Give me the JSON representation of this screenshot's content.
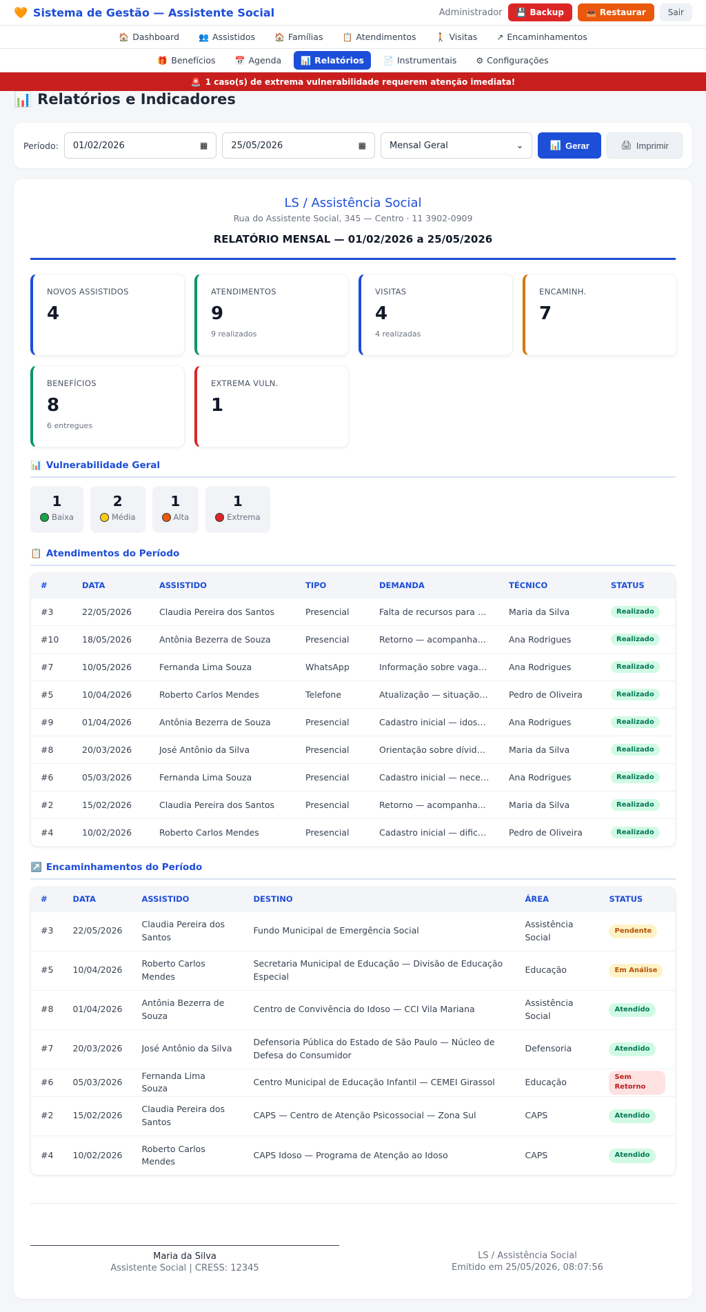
{
  "app": {
    "title": "Sistema de Gestão — Assistente Social",
    "user": "Administrador",
    "backup": "Backup",
    "restore": "Restaurar",
    "logout": "Sair"
  },
  "nav1": [
    {
      "label": "Dashboard",
      "icon": "🏠"
    },
    {
      "label": "Assistidos",
      "icon": "👥"
    },
    {
      "label": "Famílias",
      "icon": "🏠"
    },
    {
      "label": "Atendimentos",
      "icon": "📋"
    },
    {
      "label": "Visitas",
      "icon": "🚶"
    },
    {
      "label": "Encaminhamentos",
      "icon": "↗"
    }
  ],
  "nav2": [
    {
      "label": "Benefícios",
      "icon": "🎁"
    },
    {
      "label": "Agenda",
      "icon": "📅"
    },
    {
      "label": "Relatórios",
      "icon": "📊"
    },
    {
      "label": "Instrumentais",
      "icon": "📄"
    },
    {
      "label": "Configurações",
      "icon": "⚙"
    }
  ],
  "alert": "1 caso(s) de extrema vulnerabilidade requerem atenção imediata!",
  "page_title": "Relatórios e Indicadores",
  "filters": {
    "period_label": "Período:",
    "date_from": "01/02/2026",
    "date_to": "25/05/2026",
    "report_type": "Mensal Geral",
    "generate": "Gerar",
    "print": "Imprimir"
  },
  "report": {
    "org_name": "LS / Assistência Social",
    "org_address": "Rua do Assistente Social, 345 — Centro · 11 3902-0909",
    "title": "RELATÓRIO MENSAL — 01/02/2026 a 25/05/2026"
  },
  "stats": [
    {
      "label": "Novos Assistidos",
      "value": "4",
      "sub": "",
      "color": "#1d4ed8"
    },
    {
      "label": "Atendimentos",
      "value": "9",
      "sub": "9 realizados",
      "color": "#059669"
    },
    {
      "label": "Visitas",
      "value": "4",
      "sub": "4 realizadas",
      "color": "#1d4ed8"
    },
    {
      "label": "Encaminh.",
      "value": "7",
      "sub": "",
      "color": "#d97706"
    },
    {
      "label": "Benefícios",
      "value": "8",
      "sub": "6 entregues",
      "color": "#059669"
    },
    {
      "label": "Extrema Vuln.",
      "value": "1",
      "sub": "",
      "color": "#dc2626"
    }
  ],
  "vuln": {
    "title": "Vulnerabilidade Geral",
    "items": [
      {
        "count": "1",
        "label": "Baixa",
        "color": "#16a34a"
      },
      {
        "count": "2",
        "label": "Média",
        "color": "#facc15"
      },
      {
        "count": "1",
        "label": "Alta",
        "color": "#ea580c"
      },
      {
        "count": "1",
        "label": "Extrema",
        "color": "#dc2626"
      }
    ]
  },
  "atend": {
    "title": "Atendimentos do Período",
    "headers": [
      "#",
      "Data",
      "Assistido",
      "Tipo",
      "Demanda",
      "Técnico",
      "Status"
    ],
    "rows": [
      [
        "#3",
        "22/05/2026",
        "Claudia Pereira dos Santos",
        "Presencial",
        "Falta de recursos para s...",
        "Maria da Silva",
        "Realizado"
      ],
      [
        "#10",
        "18/05/2026",
        "Antônia Bezerra de Souza",
        "Presencial",
        "Retorno — acompanha...",
        "Ana Rodrigues",
        "Realizado"
      ],
      [
        "#7",
        "10/05/2026",
        "Fernanda Lima Souza",
        "WhatsApp",
        "Informação sobre vaga e...",
        "Ana Rodrigues",
        "Realizado"
      ],
      [
        "#5",
        "10/04/2026",
        "Roberto Carlos Mendes",
        "Telefone",
        "Atualização — situação ...",
        "Pedro de Oliveira",
        "Realizado"
      ],
      [
        "#9",
        "01/04/2026",
        "Antônia Bezerra de Souza",
        "Presencial",
        "Cadastro inicial — idosa ...",
        "Ana Rodrigues",
        "Realizado"
      ],
      [
        "#8",
        "20/03/2026",
        "José Antônio da Silva",
        "Presencial",
        "Orientação sobre dívida...",
        "Maria da Silva",
        "Realizado"
      ],
      [
        "#6",
        "05/03/2026",
        "Fernanda Lima Souza",
        "Presencial",
        "Cadastro inicial — neces...",
        "Ana Rodrigues",
        "Realizado"
      ],
      [
        "#2",
        "15/02/2026",
        "Claudia Pereira dos Santos",
        "Presencial",
        "Retorno — acompanha...",
        "Maria da Silva",
        "Realizado"
      ],
      [
        "#4",
        "10/02/2026",
        "Roberto Carlos Mendes",
        "Presencial",
        "Cadastro inicial — dificul...",
        "Pedro de Oliveira",
        "Realizado"
      ]
    ]
  },
  "enc": {
    "title": "Encaminhamentos do Período",
    "headers": [
      "#",
      "Data",
      "Assistido",
      "Destino",
      "Área",
      "Status"
    ],
    "rows": [
      [
        "#3",
        "22/05/2026",
        "Claudia Pereira dos Santos",
        "Fundo Municipal de Emergência Social",
        "Assistência Social",
        "Pendente"
      ],
      [
        "#5",
        "10/04/2026",
        "Roberto Carlos Mendes",
        "Secretaria Municipal de Educação — Divisão de Educação Especial",
        "Educação",
        "Em Análise"
      ],
      [
        "#8",
        "01/04/2026",
        "Antônia Bezerra de Souza",
        "Centro de Convivência do Idoso — CCI Vila Mariana",
        "Assistência Social",
        "Atendido"
      ],
      [
        "#7",
        "20/03/2026",
        "José Antônio da Silva",
        "Defensoria Pública do Estado de São Paulo — Núcleo de Defesa do Consumidor",
        "Defensoria",
        "Atendido"
      ],
      [
        "#6",
        "05/03/2026",
        "Fernanda Lima Souza",
        "Centro Municipal de Educação Infantil — CEMEI Girassol",
        "Educação",
        "Sem Retorno"
      ],
      [
        "#2",
        "15/02/2026",
        "Claudia Pereira dos Santos",
        "CAPS — Centro de Atenção Psicossocial — Zona Sul",
        "CAPS",
        "Atendido"
      ],
      [
        "#4",
        "10/02/2026",
        "Roberto Carlos Mendes",
        "CAPS Idoso — Programa de Atenção ao Idoso",
        "CAPS",
        "Atendido"
      ]
    ]
  },
  "signature": {
    "name": "Maria da Silva",
    "role": "Assistente Social | CRESS: 12345",
    "org": "LS / Assistência Social",
    "emitted": "Emitido em 25/05/2026, 08:07:56"
  }
}
